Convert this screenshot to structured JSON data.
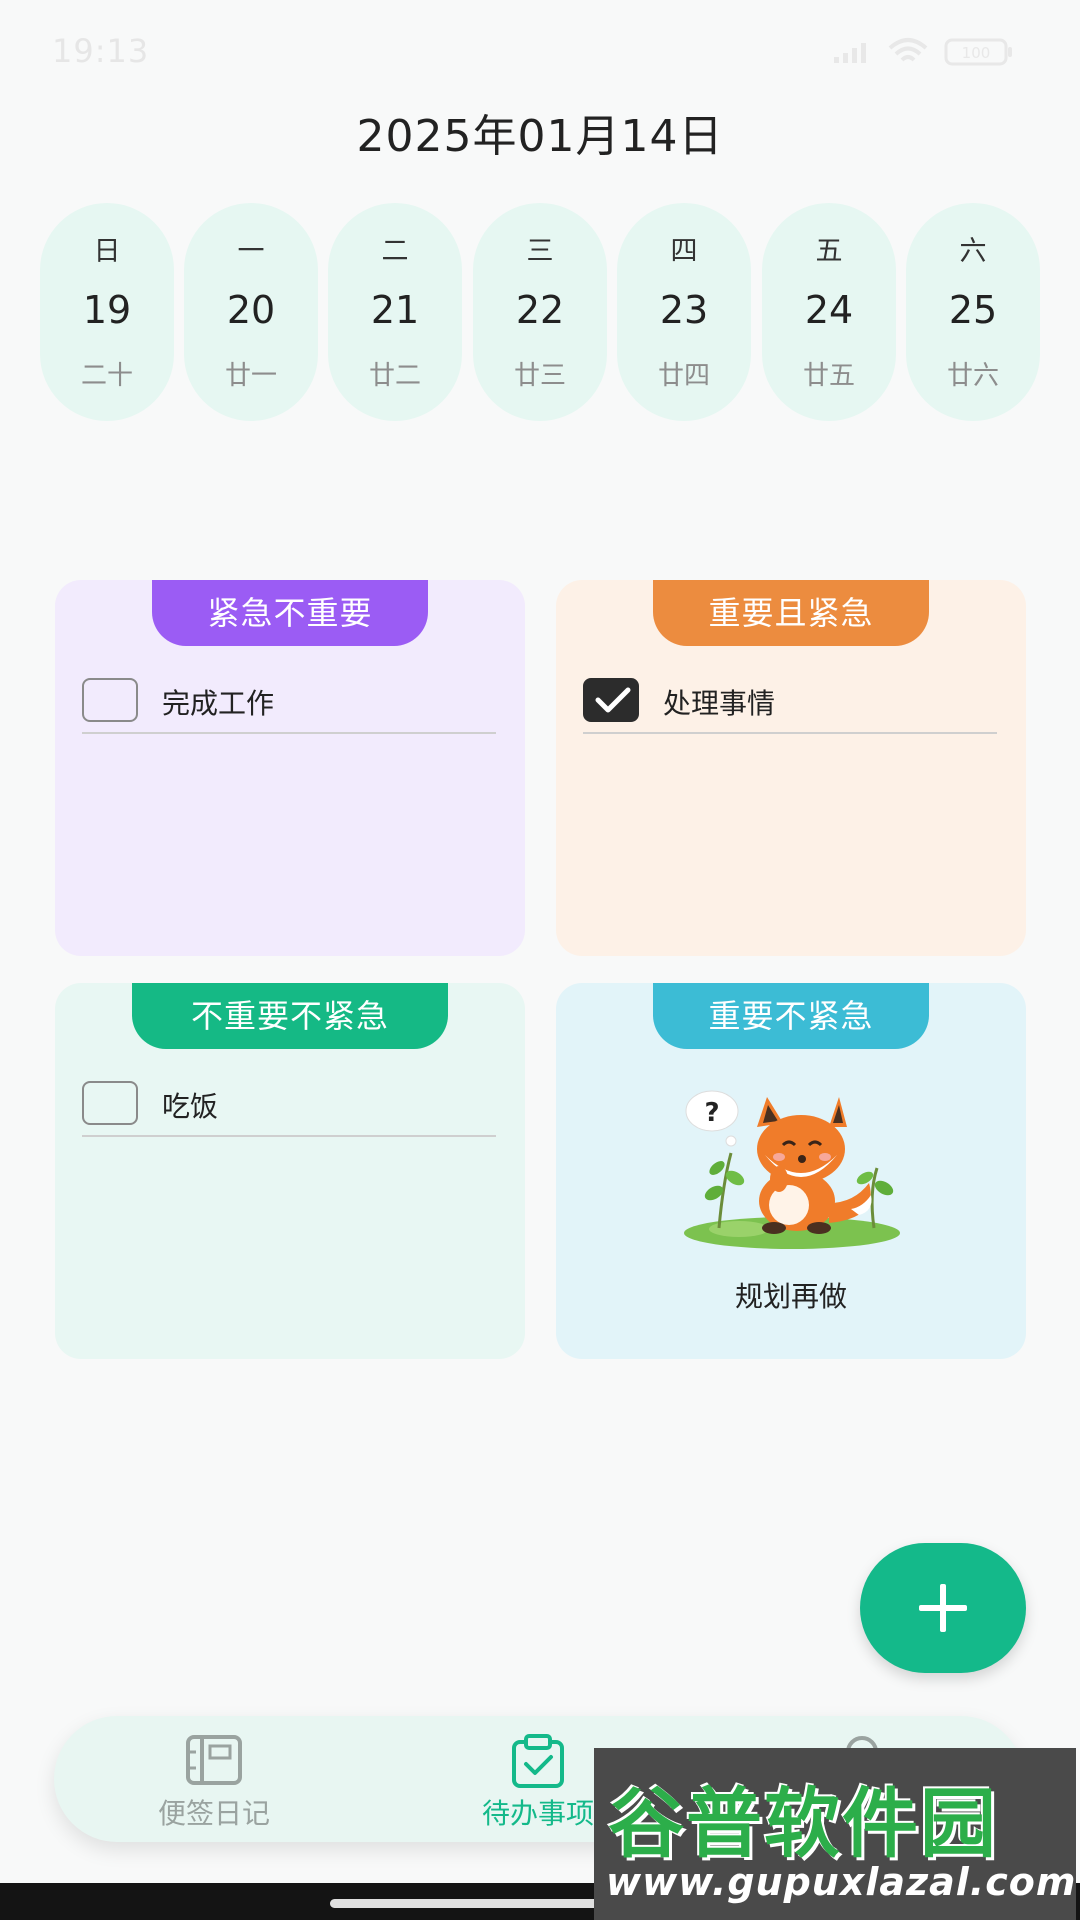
{
  "status_bar": {
    "time": "19:13",
    "battery": "100"
  },
  "header": {
    "date": "2025年01月14日"
  },
  "week": [
    {
      "weekday": "日",
      "day": "19",
      "lunar": "二十"
    },
    {
      "weekday": "一",
      "day": "20",
      "lunar": "廿一"
    },
    {
      "weekday": "二",
      "day": "21",
      "lunar": "廿二"
    },
    {
      "weekday": "三",
      "day": "22",
      "lunar": "廿三"
    },
    {
      "weekday": "四",
      "day": "23",
      "lunar": "廿四"
    },
    {
      "weekday": "五",
      "day": "24",
      "lunar": "廿五"
    },
    {
      "weekday": "六",
      "day": "25",
      "lunar": "廿六"
    }
  ],
  "quadrants": {
    "urgent_not_important": {
      "label": "紧急不重要",
      "color": "#9b5cf4",
      "background": "#f2ebfd",
      "tasks": [
        {
          "text": "完成工作",
          "checked": false
        }
      ]
    },
    "important_and_urgent": {
      "label": "重要且紧急",
      "color": "#ec8c3f",
      "background": "#fdf1e7",
      "tasks": [
        {
          "text": "处理事情",
          "checked": true
        }
      ]
    },
    "not_important_not_urgent": {
      "label": "不重要不紧急",
      "color": "#15b985",
      "background": "#e8f7f3",
      "tasks": [
        {
          "text": "吃饭",
          "checked": false
        }
      ]
    },
    "important_not_urgent": {
      "label": "重要不紧急",
      "color": "#3cbcd5",
      "background": "#e2f4f9",
      "empty_text": "规划再做",
      "empty_illustration": "thinking-fox"
    }
  },
  "fab": {
    "icon": "plus-icon"
  },
  "bottom_nav": {
    "items": [
      {
        "label": "便签日记",
        "icon": "notebook-icon",
        "active": false
      },
      {
        "label": "待办事项",
        "icon": "clipboard-check-icon",
        "active": true
      },
      {
        "label": "",
        "icon": "profile-icon",
        "active": false
      }
    ],
    "active_color": "#14b98a",
    "inactive_color": "#9aa3a0"
  },
  "watermark": {
    "main": "谷普软件园",
    "url": "www.gupuxlazal.com"
  }
}
